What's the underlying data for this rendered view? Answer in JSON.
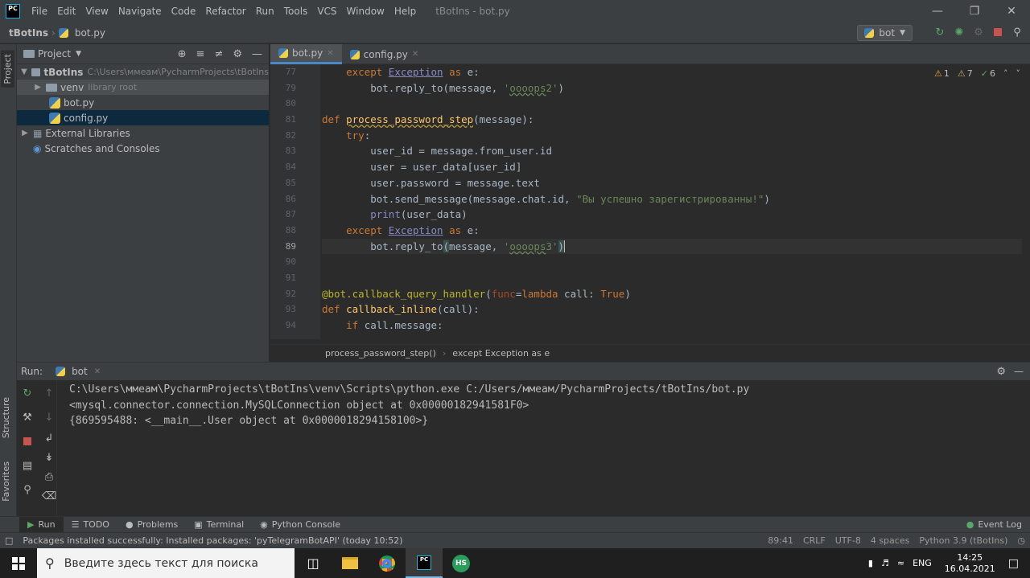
{
  "app": {
    "logo": "PC",
    "title": "tBotIns - bot.py",
    "menu": [
      "File",
      "Edit",
      "View",
      "Navigate",
      "Code",
      "Refactor",
      "Run",
      "Tools",
      "VCS",
      "Window",
      "Help"
    ],
    "window_controls": [
      "minimize",
      "restore",
      "close"
    ]
  },
  "navbar": {
    "project": "tBotIns",
    "file": "bot.py",
    "run_config": "bot",
    "icons": [
      "rerun-icon",
      "debug-icon",
      "coverage-icon",
      "stop-icon",
      "search-icon"
    ]
  },
  "side_tabs": {
    "project": "Project",
    "structure": "Structure",
    "favorites": "Favorites"
  },
  "project_panel": {
    "title": "Project",
    "tree": [
      {
        "label": "tBotIns",
        "hint": "C:\\Users\\ммеам\\PycharmProjects\\tBotIns",
        "kind": "folder",
        "expanded": true
      },
      {
        "label": "venv",
        "hint": "library root",
        "kind": "folder",
        "expanded": false
      },
      {
        "label": "bot.py",
        "kind": "python"
      },
      {
        "label": "config.py",
        "kind": "python",
        "selected": true
      },
      {
        "label": "External Libraries",
        "kind": "library",
        "expanded": false
      },
      {
        "label": "Scratches and Consoles",
        "kind": "scratch"
      }
    ]
  },
  "editor": {
    "tabs": [
      {
        "label": "bot.py",
        "active": true
      },
      {
        "label": "config.py",
        "active": false
      }
    ],
    "inspections": {
      "warnings": "1",
      "weak_warnings": "7",
      "typos": "6"
    },
    "line_numbers": [
      "77",
      "79",
      "80",
      "81",
      "82",
      "83",
      "84",
      "85",
      "86",
      "87",
      "88",
      "89",
      "90",
      "91",
      "92",
      "93",
      "94"
    ],
    "breadcrumb": [
      "process_password_step()",
      "except Exception as e"
    ]
  },
  "run_panel": {
    "label": "Run:",
    "tab": "bot",
    "output": [
      "C:\\Users\\ммеам\\PycharmProjects\\tBotIns\\venv\\Scripts\\python.exe C:/Users/ммеам/PycharmProjects/tBotIns/bot.py",
      "<mysql.connector.connection.MySQLConnection object at 0x00000182941581F0>",
      "{869595488: <__main__.User object at 0x0000018294158100>}"
    ]
  },
  "tool_windows": [
    {
      "label": "Run",
      "active": true
    },
    {
      "label": "TODO"
    },
    {
      "label": "Problems"
    },
    {
      "label": "Terminal"
    },
    {
      "label": "Python Console"
    }
  ],
  "event_log": "Event Log",
  "status": {
    "message": "Packages installed successfully: Installed packages: 'pyTelegramBotAPI' (today 10:52)",
    "position": "89:41",
    "line_sep": "CRLF",
    "encoding": "UTF-8",
    "indent": "4 spaces",
    "interpreter": "Python 3.9 (tBotIns)"
  },
  "taskbar": {
    "search_placeholder": "Введите здесь текст для поиска",
    "lang": "ENG",
    "time": "14:25",
    "date": "16.04.2021"
  },
  "colors": {
    "bg": "#2b2b2b",
    "panel": "#3c3f41",
    "keyword": "#cc7832",
    "function": "#ffc66d",
    "string": "#6a8759",
    "accent": "#4a88c7"
  }
}
